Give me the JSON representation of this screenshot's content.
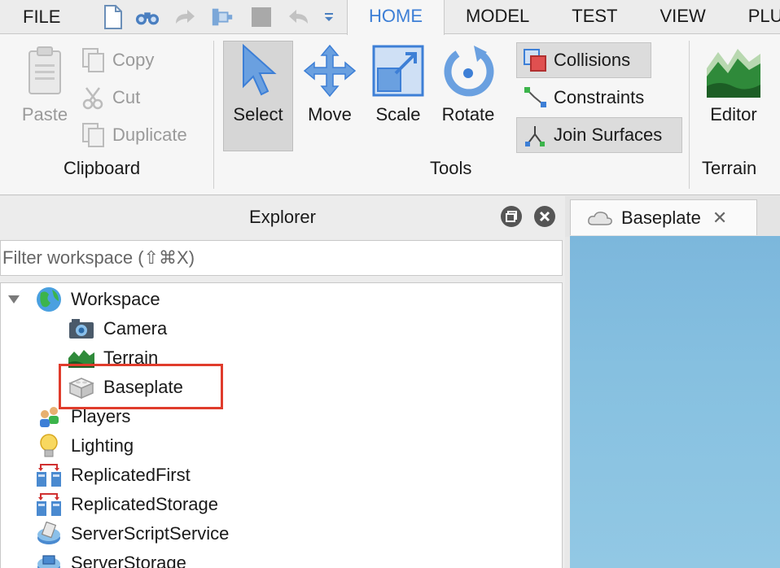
{
  "menu": {
    "file": "FILE"
  },
  "tabs": [
    "HOME",
    "MODEL",
    "TEST",
    "VIEW",
    "PLUGI"
  ],
  "active_tab": "HOME",
  "ribbon": {
    "clipboard": {
      "label": "Clipboard",
      "paste": "Paste",
      "copy": "Copy",
      "cut": "Cut",
      "duplicate": "Duplicate"
    },
    "tools": {
      "label": "Tools",
      "select": "Select",
      "move": "Move",
      "scale": "Scale",
      "rotate": "Rotate",
      "collisions": "Collisions",
      "constraints": "Constraints",
      "join_surfaces": "Join Surfaces"
    },
    "terrain": {
      "label": "Terrain",
      "editor": "Editor"
    }
  },
  "explorer": {
    "title": "Explorer",
    "filter_placeholder": "Filter workspace (⇧⌘X)",
    "items": [
      {
        "label": "Workspace",
        "icon": "globe-icon"
      },
      {
        "label": "Camera",
        "icon": "camera-icon"
      },
      {
        "label": "Terrain",
        "icon": "terrain-icon"
      },
      {
        "label": "Baseplate",
        "icon": "part-icon"
      },
      {
        "label": "Players",
        "icon": "players-icon"
      },
      {
        "label": "Lighting",
        "icon": "lightbulb-icon"
      },
      {
        "label": "ReplicatedFirst",
        "icon": "replicated-icon"
      },
      {
        "label": "ReplicatedStorage",
        "icon": "replicated-icon"
      },
      {
        "label": "ServerScriptService",
        "icon": "script-service-icon"
      },
      {
        "label": "ServerStorage",
        "icon": "storage-icon"
      }
    ]
  },
  "viewport": {
    "tab_label": "Baseplate"
  },
  "colors": {
    "accent": "#3d7fd6",
    "highlight_border": "#e03c2c",
    "sky": "#86c0e0"
  }
}
